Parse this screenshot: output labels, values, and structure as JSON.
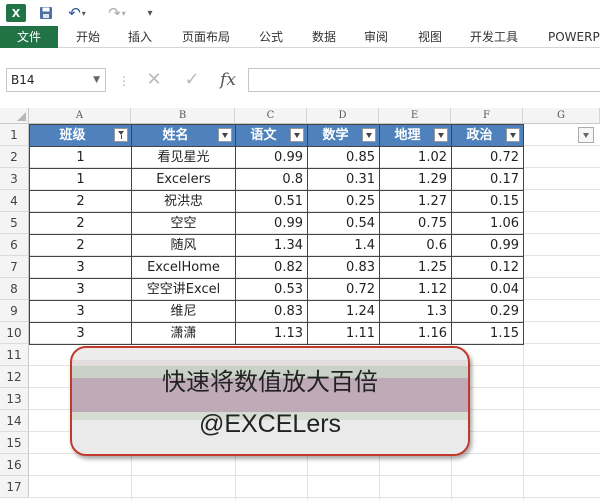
{
  "qat": {
    "logo": "X",
    "save_icon": "save-icon",
    "undo_icon": "undo-icon",
    "redo_icon": "redo-icon"
  },
  "ribbon": {
    "tabs": [
      "文件",
      "开始",
      "插入",
      "页面布局",
      "公式",
      "数据",
      "审阅",
      "视图",
      "开发工具",
      "POWERP"
    ]
  },
  "formula_bar": {
    "name_box": "B14",
    "fx_label": "fx",
    "formula": ""
  },
  "columns": [
    "A",
    "B",
    "C",
    "D",
    "E",
    "F",
    "G"
  ],
  "rows": [
    "1",
    "2",
    "3",
    "4",
    "5",
    "6",
    "7",
    "8",
    "9",
    "10",
    "11",
    "12",
    "13",
    "14",
    "15",
    "16",
    "17"
  ],
  "table": {
    "headers": [
      "班级",
      "姓名",
      "语文",
      "数学",
      "地理",
      "政治"
    ],
    "data": [
      [
        "1",
        "看见星光",
        "0.99",
        "0.85",
        "1.02",
        "0.72"
      ],
      [
        "1",
        "Excelers",
        "0.8",
        "0.31",
        "1.29",
        "0.17"
      ],
      [
        "2",
        "祝洪忠",
        "0.51",
        "0.25",
        "1.27",
        "0.15"
      ],
      [
        "2",
        "空空",
        "0.99",
        "0.54",
        "0.75",
        "1.06"
      ],
      [
        "2",
        "随风",
        "1.34",
        "1.4",
        "0.6",
        "0.99"
      ],
      [
        "3",
        "ExcelHome",
        "0.82",
        "0.83",
        "1.25",
        "0.12"
      ],
      [
        "3",
        "空空讲Excel",
        "0.53",
        "0.72",
        "1.12",
        "0.04"
      ],
      [
        "3",
        "维尼",
        "0.83",
        "1.24",
        "1.3",
        "0.29"
      ],
      [
        "3",
        "潇潇",
        "1.13",
        "1.11",
        "1.16",
        "1.15"
      ]
    ]
  },
  "banner": {
    "title": "快速将数值放大百倍",
    "subtitle": "@EXCELers"
  },
  "colors": {
    "excel_green": "#217346",
    "table_header": "#4f81bd",
    "banner_border": "#c0392b"
  }
}
